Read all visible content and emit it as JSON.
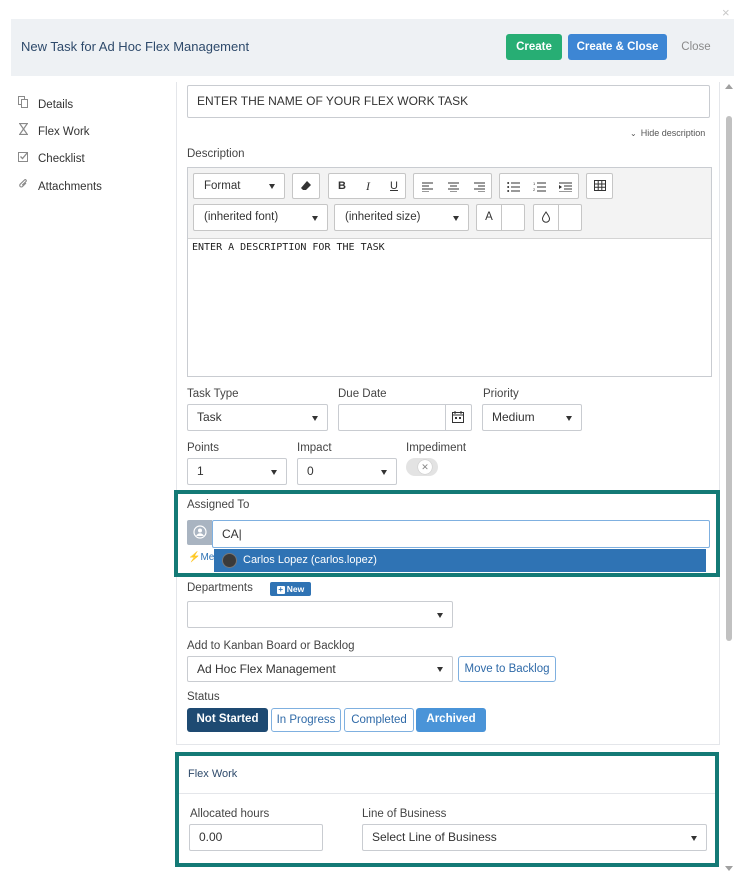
{
  "window": {
    "close_glyph": "×"
  },
  "header": {
    "title": "New Task for Ad Hoc Flex Management",
    "create_label": "Create",
    "create_close_label": "Create & Close",
    "close_label": "Close"
  },
  "sidebar": {
    "items": [
      {
        "label": "Details",
        "icon": "document-icon"
      },
      {
        "label": "Flex Work",
        "icon": "hourglass-icon"
      },
      {
        "label": "Checklist",
        "icon": "checkbox-icon"
      },
      {
        "label": "Attachments",
        "icon": "paperclip-icon"
      }
    ]
  },
  "task": {
    "name_value": "ENTER THE NAME OF YOUR FLEX WORK TASK",
    "hide_description": "Hide description",
    "description_label": "Description",
    "editor": {
      "format": "Format",
      "font": "(inherited font)",
      "size": "(inherited size)",
      "bold": "B",
      "italic": "I",
      "underline": "U",
      "text_color": "A",
      "body": "ENTER A DESCRIPTION FOR THE TASK"
    },
    "task_type_label": "Task Type",
    "task_type_value": "Task",
    "due_date_label": "Due Date",
    "due_date_value": "",
    "priority_label": "Priority",
    "priority_value": "Medium",
    "points_label": "Points",
    "points_value": "1",
    "impact_label": "Impact",
    "impact_value": "0",
    "impediment_label": "Impediment",
    "assigned_to_label": "Assigned To",
    "assigned_input_value": "CA",
    "assigned_suggestion": "Carlos Lopez (carlos.lopez)",
    "me_link": "Me",
    "departments_label": "Departments",
    "new_badge": "New",
    "departments_value": "",
    "kanban_label": "Add to Kanban Board or Backlog",
    "kanban_value": "Ad Hoc Flex Management",
    "move_backlog": "Move to Backlog",
    "status_label": "Status",
    "statuses": [
      "Not Started",
      "In Progress",
      "Completed",
      "Archived"
    ],
    "selected_status": "Not Started"
  },
  "flex_work": {
    "title": "Flex Work",
    "allocated_label": "Allocated hours",
    "allocated_value": "0.00",
    "lob_label": "Line of Business",
    "lob_value": "Select Line of Business"
  },
  "colors": {
    "create": "#27ae74",
    "primary": "#3d86d4",
    "highlight": "#147a76",
    "not_started": "#1e4a72",
    "archived": "#4a94d8"
  }
}
